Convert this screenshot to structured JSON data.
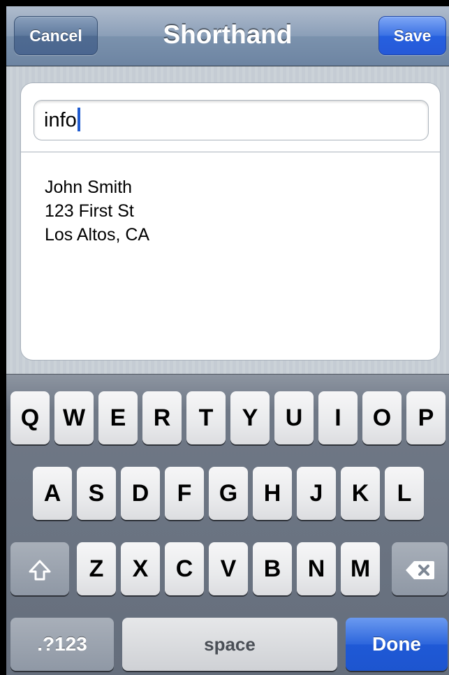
{
  "navbar": {
    "title": "Shorthand",
    "cancel_label": "Cancel",
    "save_label": "Save"
  },
  "form": {
    "shorthand_value": "info",
    "expansion_lines": [
      "John Smith",
      "123 First St",
      "Los Altos, CA"
    ]
  },
  "keyboard": {
    "row1": [
      "Q",
      "W",
      "E",
      "R",
      "T",
      "Y",
      "U",
      "I",
      "O",
      "P"
    ],
    "row2": [
      "A",
      "S",
      "D",
      "F",
      "G",
      "H",
      "J",
      "K",
      "L"
    ],
    "row3": [
      "Z",
      "X",
      "C",
      "V",
      "B",
      "N",
      "M"
    ],
    "shift_icon": "shift-arrow-icon",
    "backspace_icon": "backspace-icon",
    "numbers_label": ".?123",
    "space_label": "space",
    "done_label": "Done"
  },
  "colors": {
    "nav_bar": "#7b92ad",
    "save_button": "#2660df",
    "done_key": "#2d66dc",
    "caret": "#1f5bd0"
  }
}
